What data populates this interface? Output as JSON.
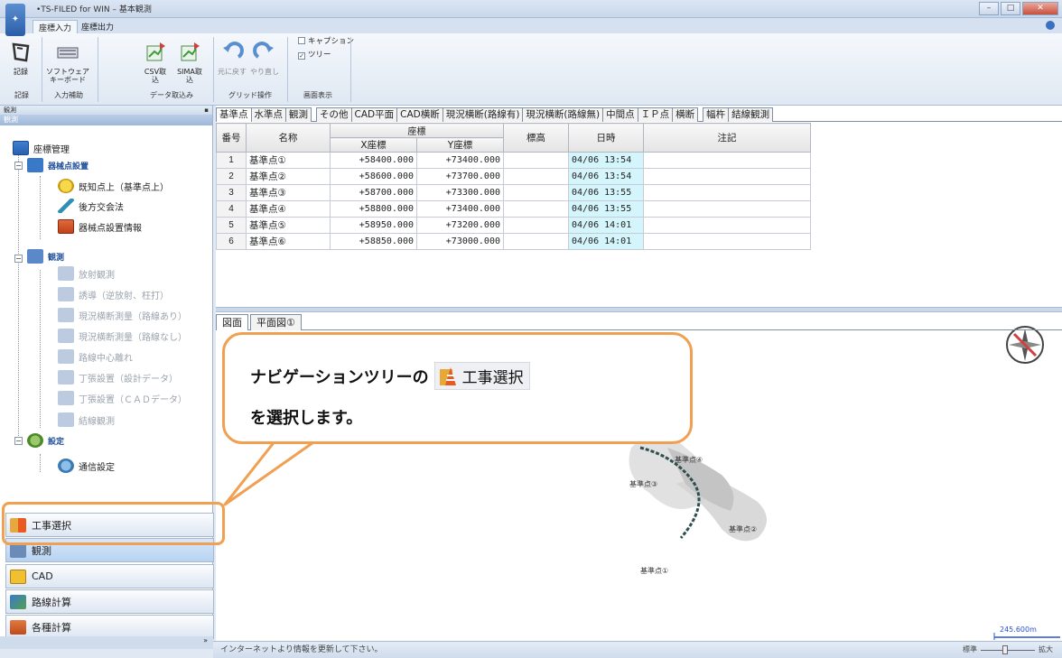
{
  "window": {
    "title": "•TS-FILED for WIN – 基本観測",
    "controls": [
      "–",
      "□",
      "✕"
    ]
  },
  "ribbon_tabs": [
    "座標入力",
    "座標出力"
  ],
  "ribbon": {
    "record": "記録",
    "software_keyboard_1": "ソフトウェア",
    "software_keyboard_2": "キーボード",
    "csv_import": "CSV取込",
    "sima_import": "SIMA取込",
    "undo": "元に戻す",
    "redo": "やり直し",
    "caption": "キャプション",
    "tree": "ツリー",
    "groups": {
      "record": "記録",
      "input_assist": "入力補助",
      "data_import": "データ取込み",
      "grid_ops": "グリッド操作",
      "display": "画面表示"
    }
  },
  "left_panel": {
    "header": "観測",
    "subheader": "観測",
    "footer": "»",
    "tree": {
      "coord_mgmt": "座標管理",
      "instrument_setup": "器械点設置",
      "known_point": "既知点上（基準点上）",
      "resection": "後方交会法",
      "instrument_info": "器械点設置情報",
      "observation": "観測",
      "radial": "放射観測",
      "guidance": "誘導（逆放射、枉打）",
      "cross_with_route": "現況横断測量（路線あり）",
      "cross_without_route": "現況横断測量（路線なし）",
      "centerline_offset": "路線中心離れ",
      "stake_design": "丁張設置（設計データ）",
      "stake_cad": "丁張設置（ＣＡＤデータ）",
      "tie_line": "結線観測",
      "settings": "設定",
      "comm_settings": "通信設定"
    },
    "nav": {
      "construction": "工事選択",
      "observation": "観測",
      "cad": "CAD",
      "route_calc": "路線計算",
      "various_calc": "各種計算"
    }
  },
  "grid": {
    "tabs": [
      "基準点",
      "水準点",
      "観測",
      "その他",
      "CAD平面",
      "CAD横断",
      "現況横断(路線有)",
      "現況横断(路線無)",
      "中間点",
      "ＩＰ点",
      "横断",
      "幅杵",
      "結線観測"
    ],
    "headers": {
      "no": "番号",
      "name": "名称",
      "coord": "座標",
      "x": "X座標",
      "y": "Y座標",
      "elev": "標高",
      "datetime": "日時",
      "note": "注記"
    },
    "rows": [
      {
        "no": "1",
        "name": "基準点①",
        "x": "+58400.000",
        "y": "+73400.000",
        "elev": "",
        "datetime": "04/06 13:54",
        "note": ""
      },
      {
        "no": "2",
        "name": "基準点②",
        "x": "+58600.000",
        "y": "+73700.000",
        "elev": "",
        "datetime": "04/06 13:54",
        "note": ""
      },
      {
        "no": "3",
        "name": "基準点③",
        "x": "+58700.000",
        "y": "+73300.000",
        "elev": "",
        "datetime": "04/06 13:55",
        "note": ""
      },
      {
        "no": "4",
        "name": "基準点④",
        "x": "+58800.000",
        "y": "+73400.000",
        "elev": "",
        "datetime": "04/06 13:55",
        "note": ""
      },
      {
        "no": "5",
        "name": "基準点⑤",
        "x": "+58950.000",
        "y": "+73200.000",
        "elev": "",
        "datetime": "04/06 14:01",
        "note": ""
      },
      {
        "no": "6",
        "name": "基準点⑥",
        "x": "+58850.000",
        "y": "+73000.000",
        "elev": "",
        "datetime": "04/06 14:01",
        "note": ""
      }
    ]
  },
  "map": {
    "tabs": [
      "図面",
      "平面図①"
    ],
    "labels": {
      "p4": "基準点④",
      "p3": "基準点③",
      "p2": "基準点②",
      "p1": "基準点①"
    },
    "scale": "245.600m"
  },
  "status": {
    "message": "インターネットより情報を更新して下さい。",
    "zoom_min": "標準",
    "zoom_max": "拡大"
  },
  "callout": {
    "line1": "ナビゲーションツリーの",
    "chip": "工事選択",
    "line2": "を選択します。"
  },
  "colors": {
    "accent_orange": "#f0a050",
    "date_cell": "#d4f5fb"
  }
}
